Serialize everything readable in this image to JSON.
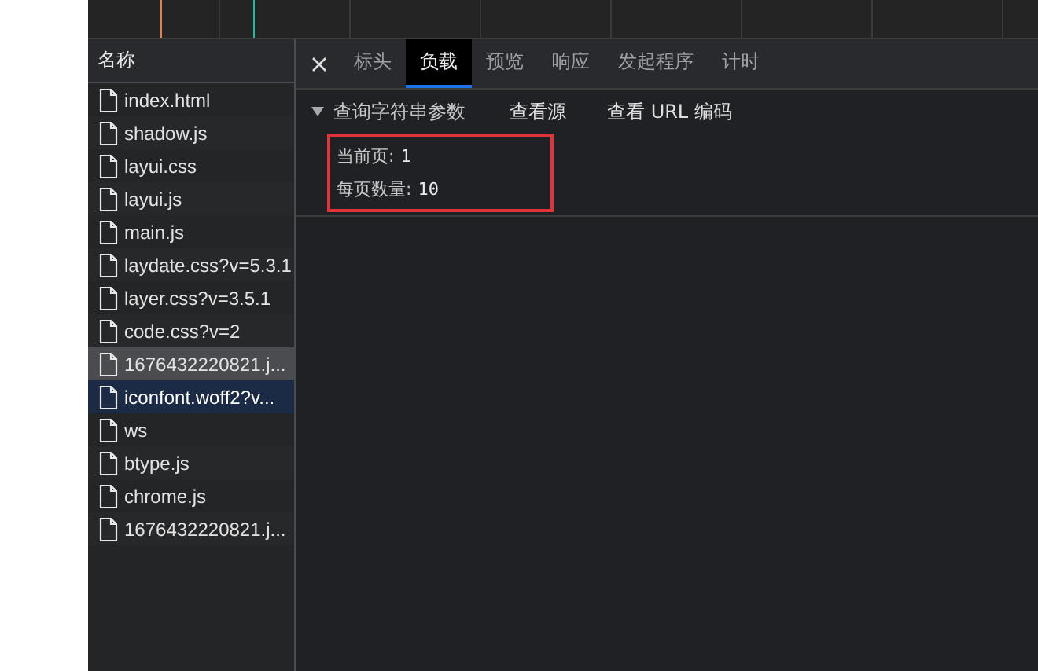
{
  "sidebar": {
    "header": "名称",
    "items": [
      {
        "name": "index.html",
        "selected": false,
        "hovered": false
      },
      {
        "name": "shadow.js",
        "selected": false,
        "hovered": false
      },
      {
        "name": "layui.css",
        "selected": false,
        "hovered": false
      },
      {
        "name": "layui.js",
        "selected": false,
        "hovered": false
      },
      {
        "name": "main.js",
        "selected": false,
        "hovered": false
      },
      {
        "name": "laydate.css?v=5.3.1",
        "selected": false,
        "hovered": false
      },
      {
        "name": "layer.css?v=3.5.1",
        "selected": false,
        "hovered": false
      },
      {
        "name": "code.css?v=2",
        "selected": false,
        "hovered": false
      },
      {
        "name": "1676432220821.j...",
        "selected": true,
        "hovered": false
      },
      {
        "name": "iconfont.woff2?v...",
        "selected": false,
        "hovered": true
      },
      {
        "name": "ws",
        "selected": false,
        "hovered": false
      },
      {
        "name": "btype.js",
        "selected": false,
        "hovered": false
      },
      {
        "name": "chrome.js",
        "selected": false,
        "hovered": false
      },
      {
        "name": "1676432220821.j...",
        "selected": false,
        "hovered": false
      }
    ]
  },
  "tabs": [
    {
      "label": "标头",
      "selected": false
    },
    {
      "label": "负载",
      "selected": true
    },
    {
      "label": "预览",
      "selected": false
    },
    {
      "label": "响应",
      "selected": false
    },
    {
      "label": "发起程序",
      "selected": false
    },
    {
      "label": "计时",
      "selected": false
    }
  ],
  "payload": {
    "section_title": "查询字符串参数",
    "expanded": true,
    "links": [
      "查看源",
      "查看 URL 编码"
    ],
    "params": [
      {
        "key": "当前页:",
        "value": "1"
      },
      {
        "key": "每页数量:",
        "value": "10"
      }
    ]
  }
}
